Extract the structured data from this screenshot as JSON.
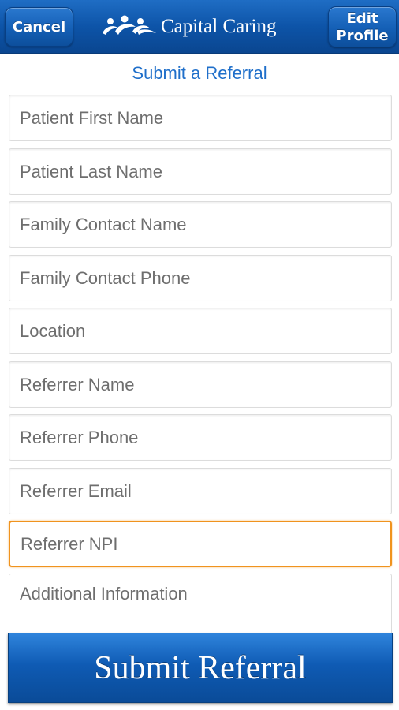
{
  "header": {
    "cancel_label": "Cancel",
    "edit_label_line1": "Edit",
    "edit_label_line2": "Profile",
    "brand_name": "Capital Caring",
    "logo_icon": "people-figures-logo",
    "background_color": "#0d54a8"
  },
  "page": {
    "subtitle": "Submit a Referral"
  },
  "form": {
    "fields": [
      {
        "placeholder": "Patient First Name",
        "value": ""
      },
      {
        "placeholder": "Patient Last Name",
        "value": ""
      },
      {
        "placeholder": "Family Contact Name",
        "value": ""
      },
      {
        "placeholder": "Family Contact Phone",
        "value": ""
      },
      {
        "placeholder": "Location",
        "value": ""
      },
      {
        "placeholder": "Referrer Name",
        "value": ""
      },
      {
        "placeholder": "Referrer Phone",
        "value": ""
      },
      {
        "placeholder": "Referrer Email",
        "value": ""
      },
      {
        "placeholder": "Referrer NPI",
        "value": "",
        "focused": true
      },
      {
        "placeholder": "Additional Information",
        "value": ""
      }
    ],
    "focus_color": "#f0931e",
    "submit_label": "Submit Referral"
  }
}
